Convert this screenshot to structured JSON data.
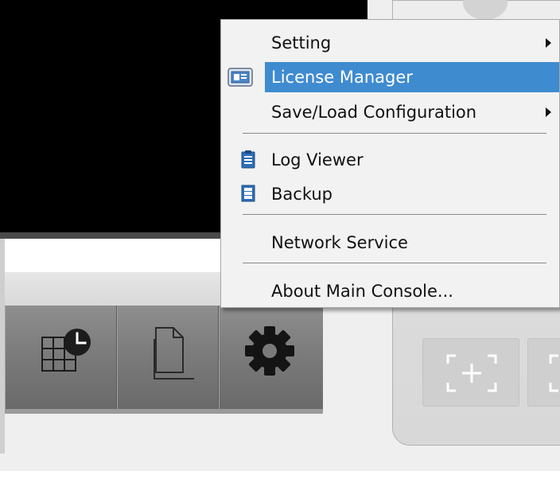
{
  "context_menu": {
    "items": [
      {
        "label": "Setting",
        "has_submenu": true
      },
      {
        "label": "License Manager",
        "icon": "license-card-icon",
        "highlighted": true
      },
      {
        "label": "Save/Load Configuration",
        "has_submenu": true
      },
      {
        "label": "Log Viewer",
        "icon": "clipboard-icon"
      },
      {
        "label": "Backup",
        "icon": "backup-icon"
      },
      {
        "label": "Network Service"
      },
      {
        "label": "About Main Console..."
      }
    ]
  },
  "toolbar": {
    "buttons": [
      {
        "icon": "schedule-grid-clock-icon"
      },
      {
        "icon": "copy-document-icon"
      },
      {
        "icon": "gear-icon"
      }
    ]
  },
  "right_panel": {
    "tiles": [
      {
        "icon": "add-view-icon"
      },
      {
        "icon": "view-frame-icon"
      }
    ]
  },
  "colors": {
    "menu_highlight": "#3f8bd0",
    "menu_background": "#f2f2f2",
    "toolbar": "#7a7a7a",
    "video_background": "#000000"
  }
}
